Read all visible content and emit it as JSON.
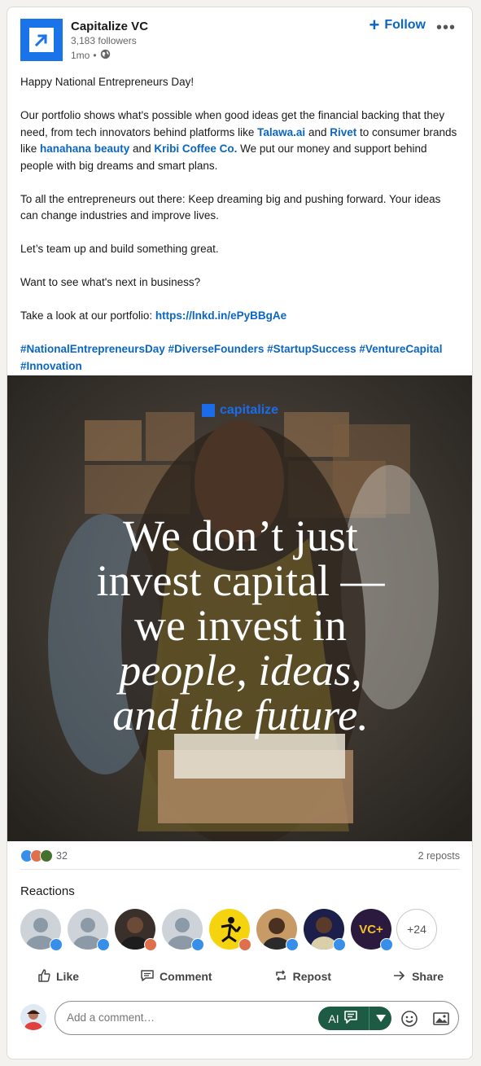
{
  "post": {
    "company": "Capitalize VC",
    "followers": "3,183 followers",
    "age": "1mo",
    "follow_label": "Follow",
    "more_label": "•••",
    "paragraphs": {
      "p1": "Happy National Entrepreneurs Day!",
      "p2_a": "Our portfolio shows what's possible when good ideas get the financial backing that they need, from tech innovators behind platforms like ",
      "p2_link1": "Talawa.ai",
      "p2_b": " and ",
      "p2_link2": "Rivet",
      "p2_c": " to consumer brands like ",
      "p2_link3": "hanahana beauty",
      "p2_d": " and ",
      "p2_link4": "Kribi Coffee Co.",
      "p2_e": " We put our money and support behind people with big dreams and smart plans.",
      "p3": "To all the entrepreneurs out there: Keep dreaming big and pushing forward. Your ideas can change industries and improve lives.",
      "p4": "Let’s team up and build something great.",
      "p5": "Want to see what's next in business?",
      "p6_a": "Take a look at our portfolio: ",
      "p6_link": "https://lnkd.in/ePyBBgAe",
      "hashtags": "#NationalEntrepreneursDay #DiverseFounders #StartupSuccess #VentureCapital #Innovation"
    }
  },
  "media": {
    "brand": "capitalize",
    "line1": "We don’t just",
    "line2": "invest capital —",
    "line3": "we invest in",
    "line4": "people, ideas,",
    "line5": "and the future."
  },
  "stats": {
    "reaction_count": "32",
    "reposts": "2 reposts"
  },
  "reactions": {
    "title": "Reactions",
    "more": "+24"
  },
  "actions": {
    "like": "Like",
    "comment": "Comment",
    "repost": "Repost",
    "share": "Share"
  },
  "comment": {
    "placeholder": "Add a comment…",
    "ai_label": "AI"
  },
  "colors": {
    "accent": "#0a66c2",
    "brand_blue": "#1a73e8",
    "ai_green": "#1d5b45"
  }
}
